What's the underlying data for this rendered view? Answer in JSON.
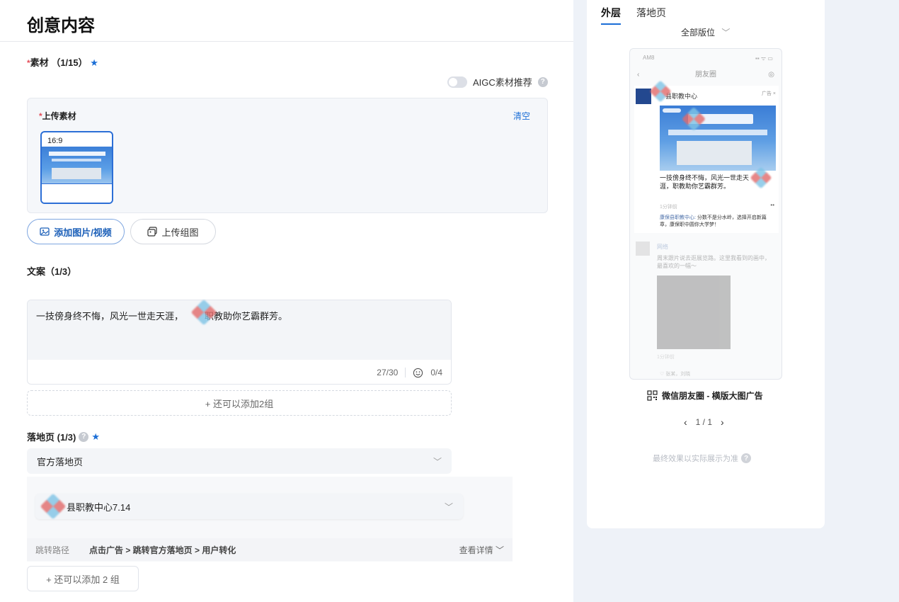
{
  "page": {
    "title": "创意内容"
  },
  "material": {
    "required_mark": "*",
    "label": "素材",
    "count": "（1/15）",
    "star": "★",
    "aigc_label": "AIGC素材推荐",
    "help": "?",
    "upload": {
      "required_mark": "*",
      "title": "上传素材",
      "clear": "清空",
      "thumb_ratio": "16:9"
    },
    "add_media_label": "添加图片/视频",
    "upload_group_label": "上传组图"
  },
  "copy": {
    "label": "文案（1/3）",
    "text_part1": "一技傍身终不悔，风光一世走天涯，",
    "text_part2": "职教助你艺霸群芳。",
    "char_count": "27/30",
    "emoji_count": "0/4",
    "add_more": "+ 还可以添加2组"
  },
  "landing": {
    "label": "落地页 (1/3)",
    "help": "?",
    "star": "★",
    "type_value": "官方落地页",
    "page_value": "县职教中心7.14",
    "path_label": "跳转路径",
    "path_value": "点击广告 > 跳转官方落地页 > 用户转化",
    "path_detail": "查看详情",
    "add_more": "+ 还可以添加 2 组"
  },
  "preview": {
    "tabs": [
      {
        "label": "外层",
        "active": true
      },
      {
        "label": "落地页",
        "active": false
      }
    ],
    "position_select": "全部版位",
    "phone": {
      "status_left": "AM8",
      "status_right": "▪▪ ᯤ ▭",
      "nav_title": "朋友圈",
      "nav_back": "‹",
      "nav_camera": "◎",
      "ad_name": "县职教中心",
      "ad_tag": "广告 ×",
      "ad_caption": "一技傍身终不悔，风光一世走天涯，职教助你艺霸群芳。",
      "ad_meta": "1分钟前",
      "ad_more": "••",
      "ad_comment_name": "康保县职教中心:",
      "ad_comment": "分数不是分水岭，选择开启新篇章，康保职中圆你大学梦！",
      "feed_name": "网络",
      "feed_text": "周末跟片说去逛展览路。这里我看到的画中，最喜欢的一幅～",
      "feed_meta": "1分钟前",
      "feed_like": "♡ 张某，刘晓"
    },
    "caption": "微信朋友圈 - 横版大图广告",
    "page_indicator": "1 / 1",
    "prev": "‹",
    "next": "›",
    "final_note": "最终效果以实际展示为准",
    "help": "?"
  },
  "colors": {
    "accent": "#1b6ed6",
    "required": "#e34d59",
    "page_bg": "#eef2f8"
  }
}
